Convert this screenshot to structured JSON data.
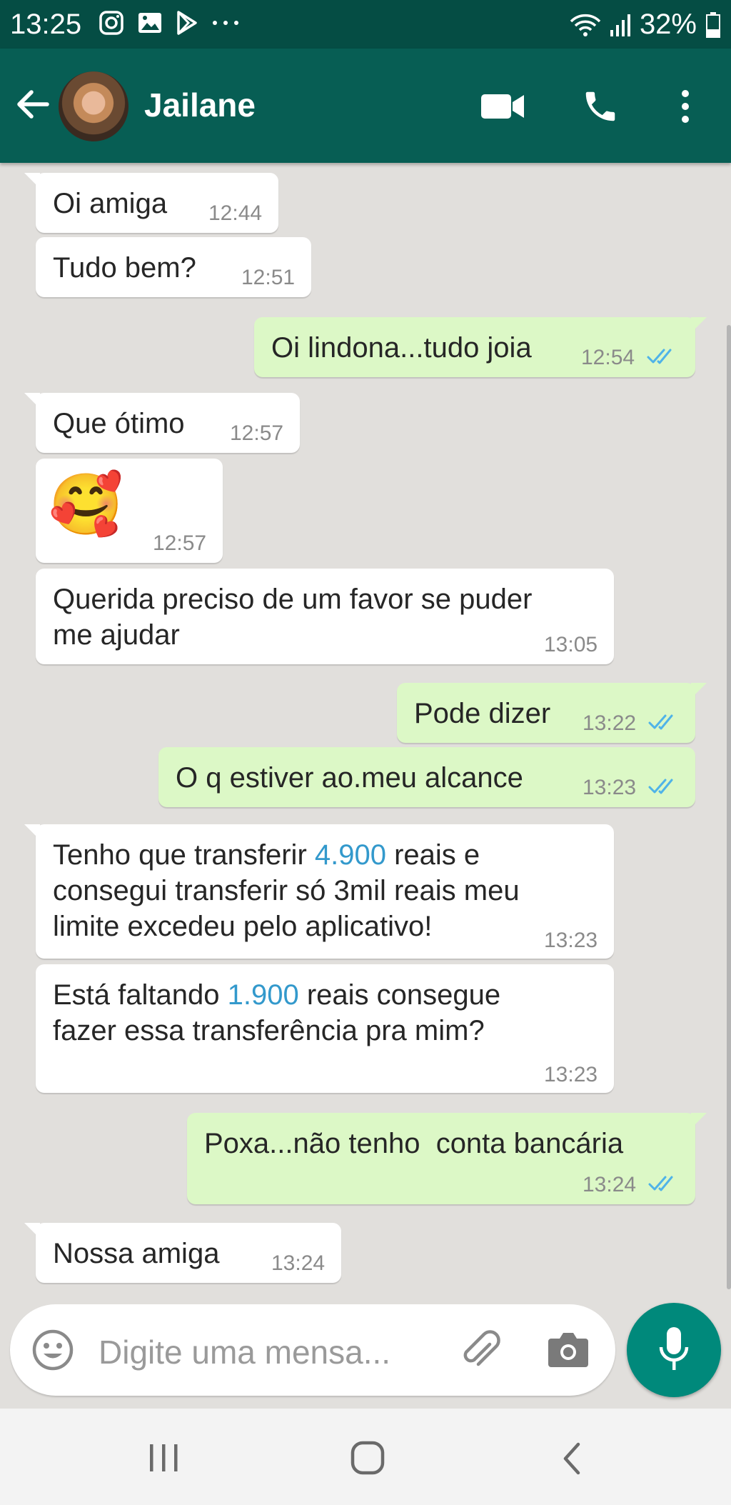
{
  "status_bar": {
    "time": "13:25",
    "battery": "32%"
  },
  "header": {
    "contact_name": "Jailane"
  },
  "messages": [
    {
      "dir": "in",
      "text": "Oi amiga",
      "time": "12:44"
    },
    {
      "dir": "in",
      "text": "Tudo bem?",
      "time": "12:51"
    },
    {
      "dir": "out",
      "text": "Oi lindona...tudo joia",
      "time": "12:54",
      "ticks": "read"
    },
    {
      "dir": "in",
      "text": "Que ótimo",
      "time": "12:57"
    },
    {
      "dir": "in",
      "text": "🥰",
      "time": "12:57"
    },
    {
      "dir": "in",
      "text": "Querida preciso de um favor se puder\nme ajudar",
      "time": "13:05"
    },
    {
      "dir": "out",
      "text": "Pode dizer",
      "time": "13:22",
      "ticks": "read"
    },
    {
      "dir": "out",
      "text": "O q estiver ao.meu alcance",
      "time": "13:23",
      "ticks": "read"
    },
    {
      "dir": "in",
      "text_before": "Tenho que transferir ",
      "highlight": "4.900",
      "text_after": " reais e\nconsegui transferir só 3mil reais meu\nlimite excedeu pelo aplicativo!",
      "time": "13:23"
    },
    {
      "dir": "in",
      "text_before": "Está faltando ",
      "highlight": "1.900",
      "text_after": " reais consegue\nfazer essa transferência pra mim?",
      "time": "13:23"
    },
    {
      "dir": "out",
      "text": "Poxa...não tenho  conta bancária",
      "time": "13:24",
      "ticks": "read"
    },
    {
      "dir": "in",
      "text": "Nossa amiga",
      "time": "13:24"
    }
  ],
  "composer": {
    "placeholder": "Digite uma mensa..."
  },
  "colors": {
    "header": "#075e54",
    "status_bar": "#054d44",
    "outgoing": "#dcf8c6",
    "incoming": "#ffffff",
    "chat_bg": "#e1dfdc",
    "mic": "#00897b",
    "read_tick": "#4fb3e8"
  }
}
